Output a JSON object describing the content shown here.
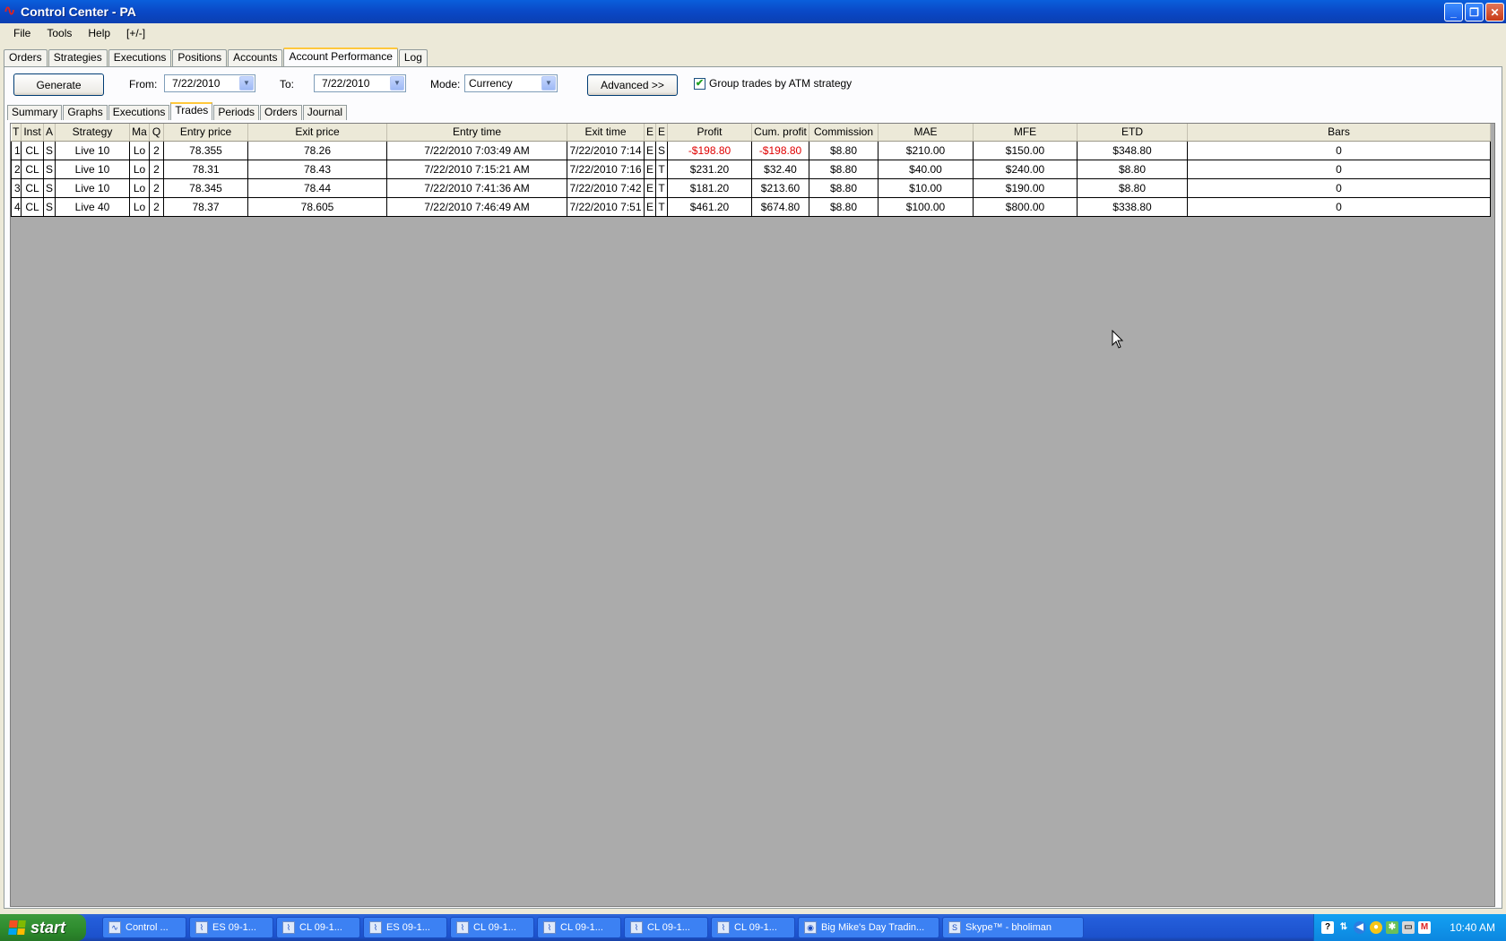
{
  "window": {
    "title": "Control Center - PA"
  },
  "menu": [
    "File",
    "Tools",
    "Help",
    "[+/-]"
  ],
  "top_tabs": [
    "Orders",
    "Strategies",
    "Executions",
    "Positions",
    "Accounts",
    "Account Performance",
    "Log"
  ],
  "toolbar": {
    "generate": "Generate",
    "from_label": "From:",
    "from_value": "7/22/2010",
    "to_label": "To:",
    "to_value": "7/22/2010",
    "mode_label": "Mode:",
    "mode_value": "Currency",
    "advanced": "Advanced >>",
    "group_label": "Group trades by ATM strategy",
    "group_checked": true
  },
  "sub_tabs": [
    "Summary",
    "Graphs",
    "Executions",
    "Trades",
    "Periods",
    "Orders",
    "Journal"
  ],
  "grid": {
    "columns": [
      "T",
      "Inst",
      "A",
      "Strategy",
      "Ma",
      "Q",
      "Entry price",
      "Exit price",
      "Entry time",
      "Exit time",
      "E",
      "E",
      "Profit",
      "Cum. profit",
      "Commission",
      "MAE",
      "MFE",
      "ETD",
      "Bars"
    ],
    "rows": [
      [
        "1",
        "CL",
        "S",
        "Live 10",
        "Lo",
        "2",
        "78.355",
        "78.26",
        "7/22/2010 7:03:49 AM",
        "7/22/2010 7:14",
        "E",
        "S",
        "-$198.80",
        "-$198.80",
        "$8.80",
        "$210.00",
        "$150.00",
        "$348.80",
        "0"
      ],
      [
        "2",
        "CL",
        "S",
        "Live 10",
        "Lo",
        "2",
        "78.31",
        "78.43",
        "7/22/2010 7:15:21 AM",
        "7/22/2010 7:16",
        "E",
        "T",
        "$231.20",
        "$32.40",
        "$8.80",
        "$40.00",
        "$240.00",
        "$8.80",
        "0"
      ],
      [
        "3",
        "CL",
        "S",
        "Live 10",
        "Lo",
        "2",
        "78.345",
        "78.44",
        "7/22/2010 7:41:36 AM",
        "7/22/2010 7:42",
        "E",
        "T",
        "$181.20",
        "$213.60",
        "$8.80",
        "$10.00",
        "$190.00",
        "$8.80",
        "0"
      ],
      [
        "4",
        "CL",
        "S",
        "Live 40",
        "Lo",
        "2",
        "78.37",
        "78.605",
        "7/22/2010 7:46:49 AM",
        "7/22/2010 7:51",
        "E",
        "T",
        "$461.20",
        "$674.80",
        "$8.80",
        "$100.00",
        "$800.00",
        "$338.80",
        "0"
      ]
    ]
  },
  "taskbar": {
    "start": "start",
    "tasks": [
      "Control ...",
      "ES 09-1...",
      "CL 09-1...",
      "ES 09-1...",
      "CL 09-1...",
      "CL 09-1...",
      "CL 09-1...",
      "CL 09-1...",
      "Big Mike's Day Tradin...",
      "Skype™ - bholiman"
    ],
    "clock": "10:40 AM"
  },
  "colors": {
    "negative": "#e00000",
    "titlebar": "#0a5fdc",
    "tab_highlight": "#ffc83c"
  }
}
